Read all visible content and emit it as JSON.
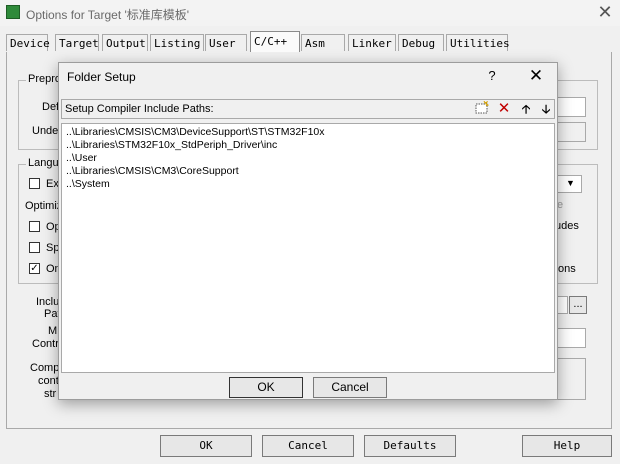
{
  "window": {
    "title": "Options for Target '标准库模板'",
    "close": "✕"
  },
  "tabs": [
    {
      "label": "Device"
    },
    {
      "label": "Target"
    },
    {
      "label": "Output"
    },
    {
      "label": "Listing"
    },
    {
      "label": "User"
    },
    {
      "label": "C/C++"
    },
    {
      "label": "Asm"
    },
    {
      "label": "Linker"
    },
    {
      "label": "Debug"
    },
    {
      "label": "Utilities"
    }
  ],
  "background": {
    "preproc": "Prepro",
    "define": "Def",
    "undefine": "Undef",
    "language": "Langu",
    "exec": "Ex",
    "optimize": "Optimiz",
    "opt1": "Op",
    "opt2": "Sp",
    "opt3": "On",
    "right_partial1": "e",
    "right_partial2": "udes",
    "right_partial3": "ons",
    "include1": "Inclu",
    "include2": "Pat",
    "misc1": "M",
    "misc2": "Contr",
    "comp1": "Comp",
    "comp2": "cont",
    "comp3": "str",
    "browse": "..."
  },
  "bottom_buttons": {
    "ok": "OK",
    "cancel": "Cancel",
    "defaults": "Defaults",
    "help": "Help"
  },
  "modal": {
    "title": "Folder Setup",
    "help": "?",
    "close": "✕",
    "header_label": "Setup Compiler Include Paths:",
    "paths": [
      "..\\Libraries\\CMSIS\\CM3\\DeviceSupport\\ST\\STM32F10x",
      "..\\Libraries\\STM32F10x_StdPeriph_Driver\\inc",
      "..\\User",
      "..\\Libraries\\CMSIS\\CM3\\CoreSupport",
      "..\\System"
    ],
    "ok": "OK",
    "cancel": "Cancel"
  }
}
